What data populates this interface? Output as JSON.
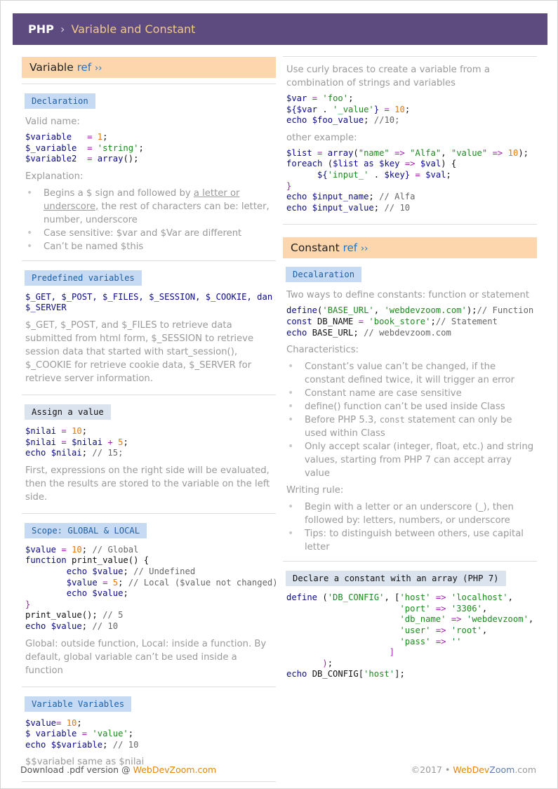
{
  "header": {
    "brand": "PHP",
    "separator": "›",
    "title": "Variable and Constant"
  },
  "left": {
    "section_title": "Variable",
    "ref_label": "ref",
    "ref_chevron": "››",
    "declaration": {
      "title": "Declaration",
      "valid_name": "Valid name:",
      "explanation": "Explanation:",
      "bullet1_pre": "Begins a $ sign and followed by ",
      "bullet1_link": "a letter or underscore,",
      "bullet1_post": " the rest of characters can be: letter, number, underscore",
      "bullet2": "Case sensitive: $var and $Var are different",
      "bullet3": "Can’t be named $this"
    },
    "predefined": {
      "title": "Predefined variables",
      "text": "$_GET, $_POST, and $_FILES to retrieve data submitted from html form, $_SESSION to retrieve session data that started with start_session(), $_COOKIE for retrieve cookie data, $_SERVER for retrieve server information."
    },
    "assign": {
      "title": "Assign a value",
      "text": "First, expressions on the right side will be evaluated, then the results are stored to the variable on the left side."
    },
    "scope": {
      "title": "Scope: GLOBAL & LOCAL",
      "text": "Global: outside function, Local: inside a function. By default, global variable can’t be used inside a function"
    },
    "varvars": {
      "title": "Variable Variables",
      "text": "$$variabel same as $nilai"
    }
  },
  "right": {
    "curly_text": "Use curly braces to create a variable from a combination of strings and variables",
    "other_example": "other example:",
    "section_title": "Constant",
    "ref_label": "ref",
    "ref_chevron": "››",
    "declaration": {
      "title": "Decalaration",
      "intro": "Two ways to define constants: function or statement",
      "characteristics": "Characteristics:",
      "c1": "Constant’s value can’t be changed, if the constant defined twice, it will trigger an error",
      "c2": "Constant name are case sensitive",
      "c3": "define() function can’t be used inside Class",
      "c4_pre": "Before PHP 5.3, ",
      "c4_code": "const",
      "c4_post": " statement can only be used within Class",
      "c5": "Only accept scalar (integer, float, etc.) and string values, starting from PHP 7 can accept array value",
      "writing_rule": "Writing rule:",
      "w1": "Begin with a letter or an underscore (_), then followed by: letters, numbers, or underscore",
      "w2": "Tips: to distinguish between others, use capital letter"
    },
    "array_const": {
      "title": "Declare a constant with an array (PHP 7)"
    }
  },
  "footer": {
    "download_text": "Download .pdf version @ ",
    "download_site": "WebDevZoom.com",
    "copyright": "©2017 • ",
    "site_part1": "WebDev",
    "site_part2": "Zoom",
    "site_part3": ".com"
  },
  "colors": {
    "header_bg": "#5d4a7e",
    "section_head_bg": "#fdd6ad",
    "sub_blue_bg": "#c6dbf3",
    "sub_gray_bg": "#dbe3ee",
    "accent_orange": "#e38414",
    "link_blue": "#1d73c9"
  }
}
